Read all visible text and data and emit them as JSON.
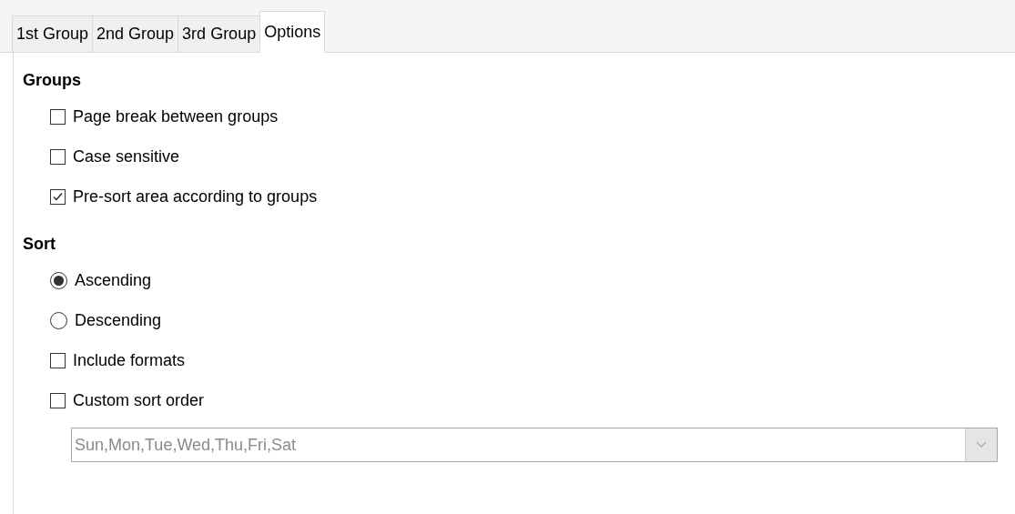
{
  "tabs": [
    {
      "label": "1st Group",
      "selected": false
    },
    {
      "label": "2nd Group",
      "selected": false
    },
    {
      "label": "3rd Group",
      "selected": false
    },
    {
      "label": "Options",
      "selected": true
    }
  ],
  "sections": [
    {
      "title": "Groups",
      "items": [
        {
          "kind": "checkbox",
          "label": "Page break between groups",
          "checked": false
        },
        {
          "kind": "checkbox",
          "label": "Case sensitive",
          "checked": false
        },
        {
          "kind": "checkbox",
          "label": "Pre-sort area according to groups",
          "checked": true
        }
      ]
    },
    {
      "title": "Sort",
      "items": [
        {
          "kind": "radio",
          "label": "Ascending",
          "selected": true
        },
        {
          "kind": "radio",
          "label": "Descending",
          "selected": false
        },
        {
          "kind": "checkbox",
          "label": "Include formats",
          "checked": false
        },
        {
          "kind": "checkbox",
          "label": "Custom sort order",
          "checked": false
        }
      ]
    }
  ],
  "sort_order_dropdown": {
    "value": "Sun,Mon,Tue,Wed,Thu,Fri,Sat",
    "disabled": true
  }
}
